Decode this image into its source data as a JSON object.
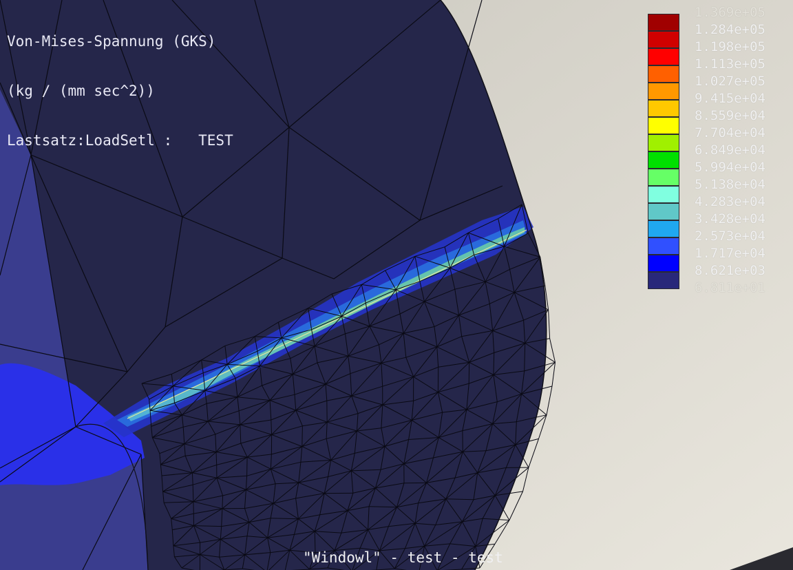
{
  "viewport": {
    "title_lines": [
      "Von-Mises-Spannung (GKS)",
      "(kg / (mm sec^2))",
      "Lastsatz:LoadSetl :   TEST"
    ],
    "window_caption": "\"Windowl\" - test - test"
  },
  "legend": {
    "labels": [
      "1.369e+05",
      "1.284e+05",
      "1.198e+05",
      "1.113e+05",
      "1.027e+05",
      "9.415e+04",
      "8.559e+04",
      "7.704e+04",
      "6.849e+04",
      "5.994e+04",
      "5.138e+04",
      "4.283e+04",
      "3.428e+04",
      "2.573e+04",
      "1.717e+04",
      "8.621e+03",
      "6.811e+01"
    ],
    "colors": [
      "#a00000",
      "#d00000",
      "#ff0000",
      "#ff6000",
      "#ff9800",
      "#ffc800",
      "#ffff00",
      "#a0f000",
      "#00e000",
      "#66ff66",
      "#80ffe0",
      "#60c8c8",
      "#20a8f0",
      "#3050ff",
      "#0000ff",
      "#28287a"
    ]
  },
  "colors": {
    "background": "#d8d4ca",
    "mesh_surface": "#25264a",
    "mesh_lines": "#0a0a14",
    "left_part": "#3a3d8e",
    "low_stress": "#2b30e6"
  }
}
